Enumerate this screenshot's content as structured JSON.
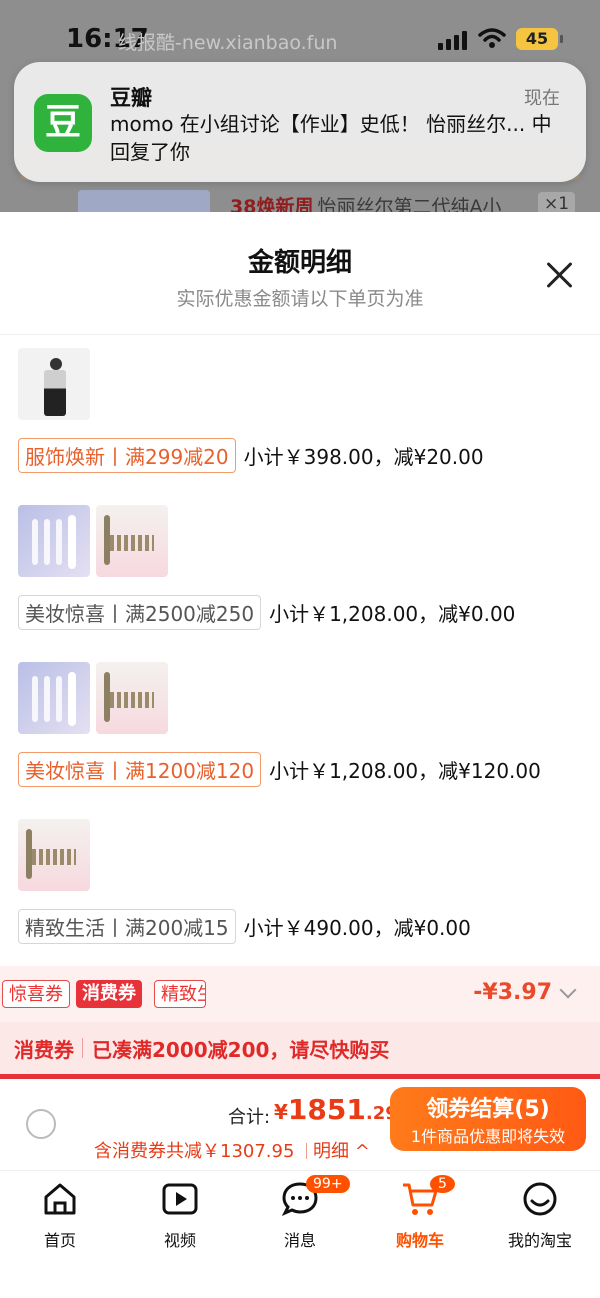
{
  "status_bar": {
    "time": "16:17",
    "watermark": "线报酷-new.xianbao.fun",
    "battery": "45"
  },
  "notification": {
    "app_icon_char": "豆",
    "app_name": "豆瓣",
    "time": "现在",
    "body": "momo 在小组讨论【作业】史低！ 怡丽丝尔... 中回复了你"
  },
  "background_item": {
    "tag": "38焕新周",
    "title": "怡丽丝尔第二代纯A小",
    "qty": "×1"
  },
  "sheet": {
    "title": "金额明细",
    "subtitle": "实际优惠金额请以下单页为准",
    "groups": [
      {
        "tag": "服饰焕新丨满299减20",
        "subtotal": "小计￥398.00，减¥20.00"
      },
      {
        "tag": "美妆惊喜丨满2500减250",
        "subtotal": "小计￥1,208.00，减¥0.00"
      },
      {
        "tag": "美妆惊喜丨满1200减120",
        "subtotal": "小计￥1,208.00，减¥120.00"
      },
      {
        "tag": "精致生活丨满200减15",
        "subtotal": "小计￥490.00，减¥0.00"
      }
    ]
  },
  "coupon_bar": {
    "tabs": [
      "惊喜券",
      "消费券",
      "精致生"
    ],
    "amount": "-¥3.97",
    "message_label": "消费券",
    "message": "已凑满2000减200，请尽快购买"
  },
  "checkout": {
    "total_label": "合计:",
    "total_symbol": "¥",
    "total_int": "1851",
    "total_dec": ".29",
    "discount": "含消费券共减￥1307.95",
    "detail": "明细",
    "button_main": "领券结算(5)",
    "button_sub": "1件商品优惠即将失效"
  },
  "tabbar": {
    "items": [
      {
        "label": "首页",
        "icon": "home-icon"
      },
      {
        "label": "视频",
        "icon": "video-icon"
      },
      {
        "label": "消息",
        "icon": "message-icon",
        "badge": "99+"
      },
      {
        "label": "购物车",
        "icon": "cart-icon",
        "badge": "5"
      },
      {
        "label": "我的淘宝",
        "icon": "profile-icon"
      }
    ]
  },
  "colors": {
    "accent": "#ff5000",
    "coupon_red": "#e8323a",
    "green": "#2fb33d"
  }
}
